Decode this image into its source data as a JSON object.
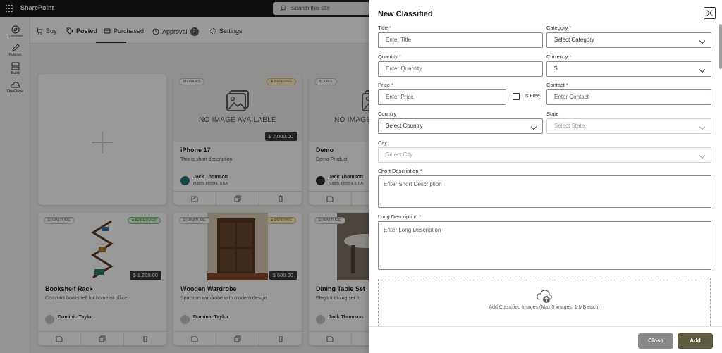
{
  "app": {
    "name": "SharePoint",
    "search_placeholder": "Search this site"
  },
  "leftrail": {
    "items": [
      {
        "label": "Discover",
        "icon": "discover-icon"
      },
      {
        "label": "Publish",
        "icon": "publish-icon"
      },
      {
        "label": "Build",
        "icon": "build-icon"
      },
      {
        "label": "OneDrive",
        "icon": "onedrive-icon"
      }
    ]
  },
  "tabs": [
    {
      "label": "Buy",
      "icon": "cart-icon"
    },
    {
      "label": "Posted",
      "icon": "tag-icon",
      "active": true
    },
    {
      "label": "Purchased",
      "icon": "purchased-icon"
    },
    {
      "label": "Approval",
      "icon": "clock-icon",
      "badge": "2"
    },
    {
      "label": "Settings",
      "icon": "gear-icon"
    }
  ],
  "no_image_text": "NO IMAGE AVAILABLE",
  "cards": [
    {
      "category": "MOBILES",
      "status": "PENDING",
      "price": "$ 2,000.00",
      "title": "iPhone 17",
      "desc": "This is short description",
      "name": "Jack Thomson",
      "location": "Miami, Florida, USA"
    },
    {
      "category": "BOOKS",
      "price": "",
      "title": "Demo",
      "desc": "Demo Product",
      "name": "Jack Thomson",
      "location": "Miami, Florida, USA"
    },
    {
      "category": "FURNITURE",
      "status": "APPROVED",
      "price": "$ 1,200.00",
      "title": "Bookshelf Rack",
      "desc": "Compact bookshelf for home or office.",
      "name": "Dominic Taylor"
    },
    {
      "category": "FURNITURE",
      "status": "PENDING",
      "price": "$ 600.00",
      "title": "Wooden Wardrobe",
      "desc": "Spacious wardrobe with modern design.",
      "name": "Dominic Taylor"
    },
    {
      "category": "FURNITURE",
      "title": "Dining Table Set",
      "desc": "Elegant dining set fo",
      "name": "Jack Thomson"
    }
  ],
  "panel": {
    "title": "New Classified",
    "fields": {
      "title": {
        "label": "Title",
        "placeholder": "Enter Title"
      },
      "category": {
        "label": "Category",
        "placeholder": "Select Category"
      },
      "quantity": {
        "label": "Quantity",
        "placeholder": "Enter Quantity"
      },
      "currency": {
        "label": "Currency",
        "value": "$"
      },
      "price": {
        "label": "Price",
        "placeholder": "Enter Price"
      },
      "is_free": {
        "label": "Is Free"
      },
      "contact": {
        "label": "Contact",
        "placeholder": "Enter Contact"
      },
      "country": {
        "label": "Country",
        "placeholder": "Select Country"
      },
      "state": {
        "label": "State",
        "placeholder": "Select State"
      },
      "city": {
        "label": "City",
        "placeholder": "Select City"
      },
      "short_desc": {
        "label": "Short Description",
        "placeholder": "Enter Short Description"
      },
      "long_desc": {
        "label": "Long Description",
        "placeholder": "Enter Long Description"
      }
    },
    "required_mark": "*",
    "upload_text": "Add Classified Images (Max 5 images, 1 MB each)",
    "close_label": "Close",
    "add_label": "Add"
  }
}
